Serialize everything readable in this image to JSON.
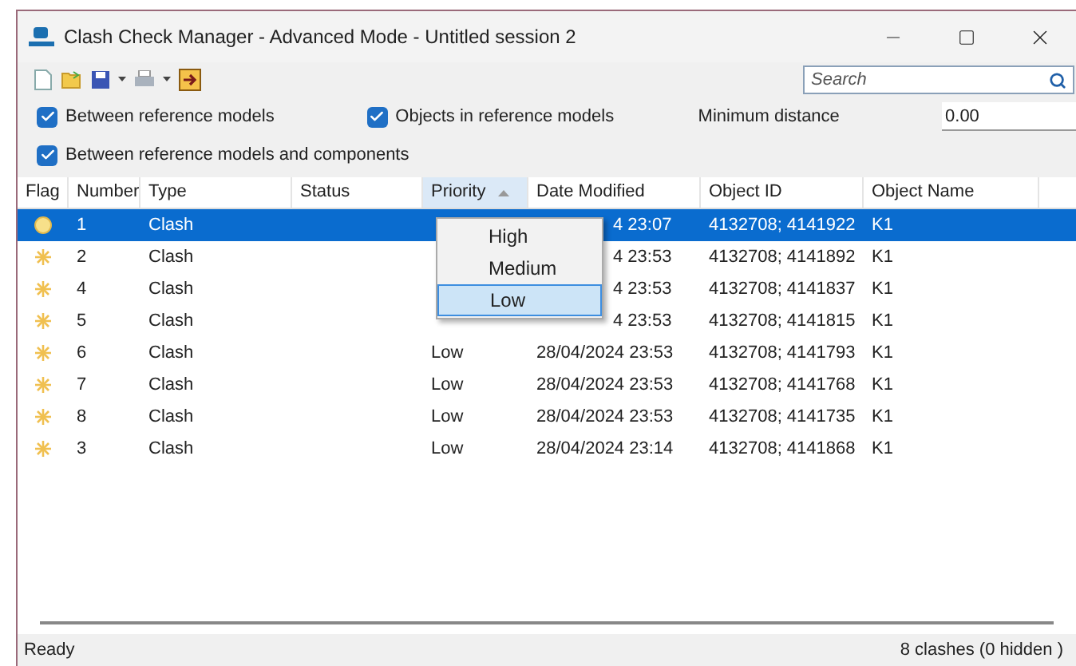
{
  "window": {
    "title": "Clash Check Manager - Advanced Mode - Untitled session 2"
  },
  "search": {
    "placeholder": "Search"
  },
  "options": [
    {
      "label": "Between reference models",
      "checked": true
    },
    {
      "label": "Objects in reference models",
      "checked": true
    },
    {
      "label": "Between reference models and components",
      "checked": true
    }
  ],
  "minimum_distance": {
    "label": "Minimum distance",
    "value": "0.00"
  },
  "table": {
    "columns": [
      {
        "label": "Flag",
        "sorted": false
      },
      {
        "label": "Number",
        "sorted": false
      },
      {
        "label": "Type",
        "sorted": false
      },
      {
        "label": "Status",
        "sorted": false
      },
      {
        "label": "Priority",
        "sorted": true
      },
      {
        "label": "Date Modified",
        "sorted": false
      },
      {
        "label": "Object ID",
        "sorted": false
      },
      {
        "label": "Object Name",
        "sorted": false
      }
    ],
    "rows": [
      {
        "selected": true,
        "covered": true,
        "number": "1",
        "type": "Clash",
        "priority": "",
        "date": "4 23:07",
        "object_id": "4132708; 4141922",
        "object_name": "K1"
      },
      {
        "selected": false,
        "covered": true,
        "number": "2",
        "type": "Clash",
        "priority": "",
        "date": "4 23:53",
        "object_id": "4132708; 4141892",
        "object_name": "K1"
      },
      {
        "selected": false,
        "covered": true,
        "number": "4",
        "type": "Clash",
        "priority": "",
        "date": "4 23:53",
        "object_id": "4132708; 4141837",
        "object_name": "K1"
      },
      {
        "selected": false,
        "covered": true,
        "number": "5",
        "type": "Clash",
        "priority": "",
        "date": "4 23:53",
        "object_id": "4132708; 4141815",
        "object_name": "K1"
      },
      {
        "selected": false,
        "covered": false,
        "number": "6",
        "type": "Clash",
        "priority": "Low",
        "date": "28/04/2024 23:53",
        "object_id": "4132708; 4141793",
        "object_name": "K1"
      },
      {
        "selected": false,
        "covered": false,
        "number": "7",
        "type": "Clash",
        "priority": "Low",
        "date": "28/04/2024 23:53",
        "object_id": "4132708; 4141768",
        "object_name": "K1"
      },
      {
        "selected": false,
        "covered": false,
        "number": "8",
        "type": "Clash",
        "priority": "Low",
        "date": "28/04/2024 23:53",
        "object_id": "4132708; 4141735",
        "object_name": "K1"
      },
      {
        "selected": false,
        "covered": false,
        "number": "3",
        "type": "Clash",
        "priority": "Low",
        "date": "28/04/2024 23:14",
        "object_id": "4132708; 4141868",
        "object_name": "K1"
      }
    ]
  },
  "priority_menu": [
    {
      "label": "High",
      "selected": false
    },
    {
      "label": "Medium",
      "selected": false
    },
    {
      "label": "Low",
      "selected": true
    }
  ],
  "status_bar": {
    "left": "Ready",
    "right": "8 clashes (0 hidden )"
  }
}
